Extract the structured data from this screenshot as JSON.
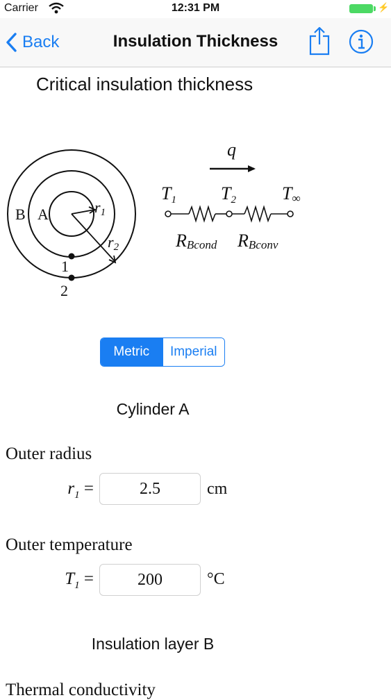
{
  "status_bar": {
    "carrier": "Carrier",
    "time": "12:31 PM"
  },
  "nav": {
    "back_label": "Back",
    "title": "Insulation Thickness"
  },
  "heading": "Critical insulation thickness",
  "diagram": {
    "flow_label": "q",
    "layer_b": "B",
    "layer_a": "A",
    "r1": "r",
    "r1_sub": "1",
    "r2": "r",
    "r2_sub": "2",
    "point_1": "1",
    "point_2": "2",
    "t1": "T",
    "t1_sub": "1",
    "t2": "T",
    "t2_sub": "2",
    "tinf": "T",
    "tinf_sub": "∞",
    "r_cond": "R",
    "r_cond_sub": "Bcond",
    "r_conv": "R",
    "r_conv_sub": "Bconv"
  },
  "units_toggle": {
    "metric": "Metric",
    "imperial": "Imperial",
    "selected": "Metric"
  },
  "cylinder_a": {
    "title": "Cylinder A",
    "outer_radius": {
      "label": "Outer radius",
      "var": "r",
      "sub": "1",
      "eq": " =",
      "value": "2.5",
      "unit": "cm"
    },
    "outer_temperature": {
      "label": "Outer temperature",
      "var": "T",
      "sub": "1",
      "eq": " =",
      "value": "200",
      "unit": "°C"
    }
  },
  "insulation_b": {
    "title": "Insulation layer B",
    "thermal_conductivity": {
      "label": "Thermal conductivity"
    }
  },
  "colors": {
    "accent": "#1a7ef2",
    "battery": "#4cd964",
    "navbar_bg": "#f8f8f8"
  }
}
